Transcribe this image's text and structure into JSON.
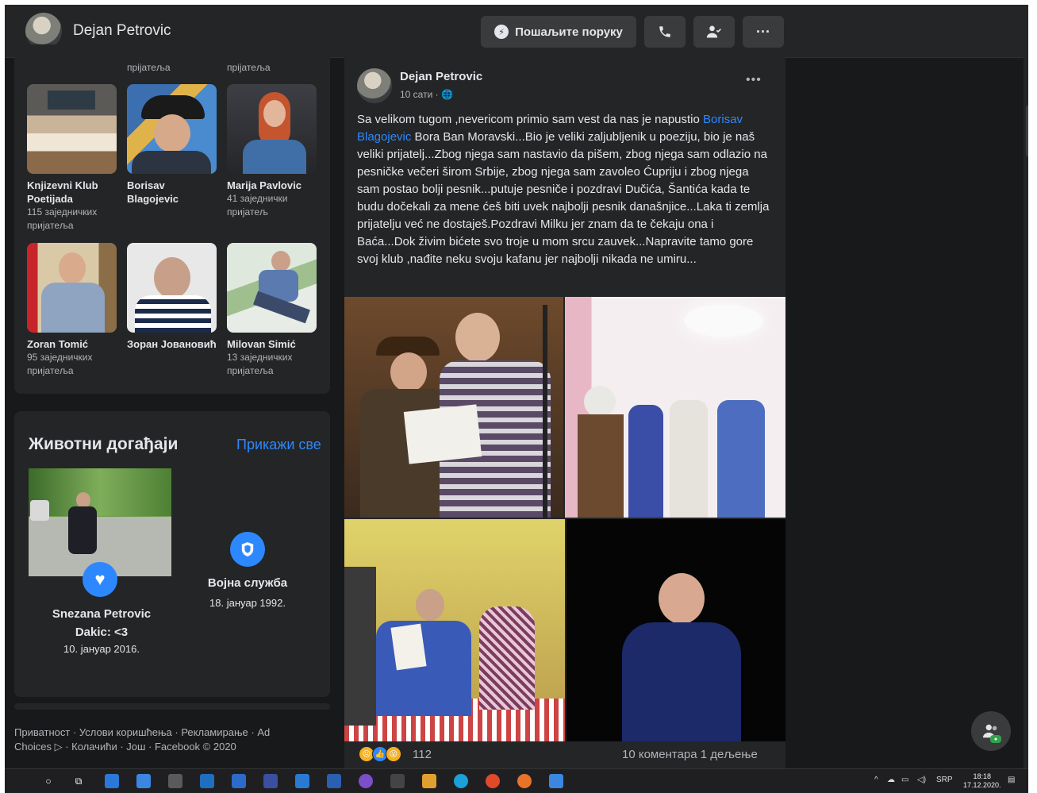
{
  "header": {
    "profile_name": "Dejan Petrovic",
    "message_button": "Пошаљите поруку",
    "more_label": "···"
  },
  "friends": {
    "cutoff_left": "прijатеља",
    "cutoff_mid": "прijатеља",
    "items": [
      {
        "name": "Knjizevni Klub Poetijada",
        "mutual": "115 заједничких пријатеља"
      },
      {
        "name": "Borisav Blagojevic",
        "mutual": ""
      },
      {
        "name": "Marija Pavlovic",
        "mutual": "41 заједнички пријатељ"
      },
      {
        "name": "Zoran Tomić",
        "mutual": "95 заједничких пријатеља"
      },
      {
        "name": "Зоран Јовановић",
        "mutual": ""
      },
      {
        "name": "Milovan Simić",
        "mutual": "13 заједничких пријатеља"
      }
    ]
  },
  "life_events": {
    "title": "Животни догађаји",
    "see_all": "Прикажи све",
    "event1": {
      "name": "Snezana Petrovic Dakic: <3",
      "date": "10. јануар 2016."
    },
    "event2": {
      "name": "Војна служба",
      "date": "18. јануар 1992."
    }
  },
  "footer": {
    "text": "Приватност · Услови коришћења · Рекламирање · Ad Choices ▷ · Колачићи · Још · Facebook © 2020"
  },
  "post": {
    "author": "Dejan Petrovic",
    "time": "10 сати · ",
    "text_before": "Sa velikom tugom ,nevericom primio sam vest da nas je napustio ",
    "tagged": "Borisav Blagojevic",
    "text_after": " Bora Ban Moravski...Bio je veliki zaljubljenik u poeziju, bio je naš veliki prijatelj...Zbog njega sam nastavio da pišem, zbog njega sam odlazio na pesničke večeri širom Srbije, zbog njega sam zavoleo Ćupriju i zbog njega sam postao bolji pesnik...putuje pesniče i pozdravi Dučića, Šantića kada te budu dočekali za mene ćeš biti uvek najbolji pesnik današnjice...Laka ti zemlja prijatelju već ne dostaješ.Pozdravi Milku jer znam da te čekaju ona i Baća...Dok živim bićete svo troje u mom srcu zauvek...Napravite tamo gore svoj klub ,nađite neku svoju kafanu jer najbolji nikada ne umiru...",
    "reactions_count": "112",
    "comments_shares": "10 коментара  1 дељење"
  },
  "taskbar": {
    "lang": "SRP",
    "time": "18:18",
    "date": "17.12.2020."
  }
}
